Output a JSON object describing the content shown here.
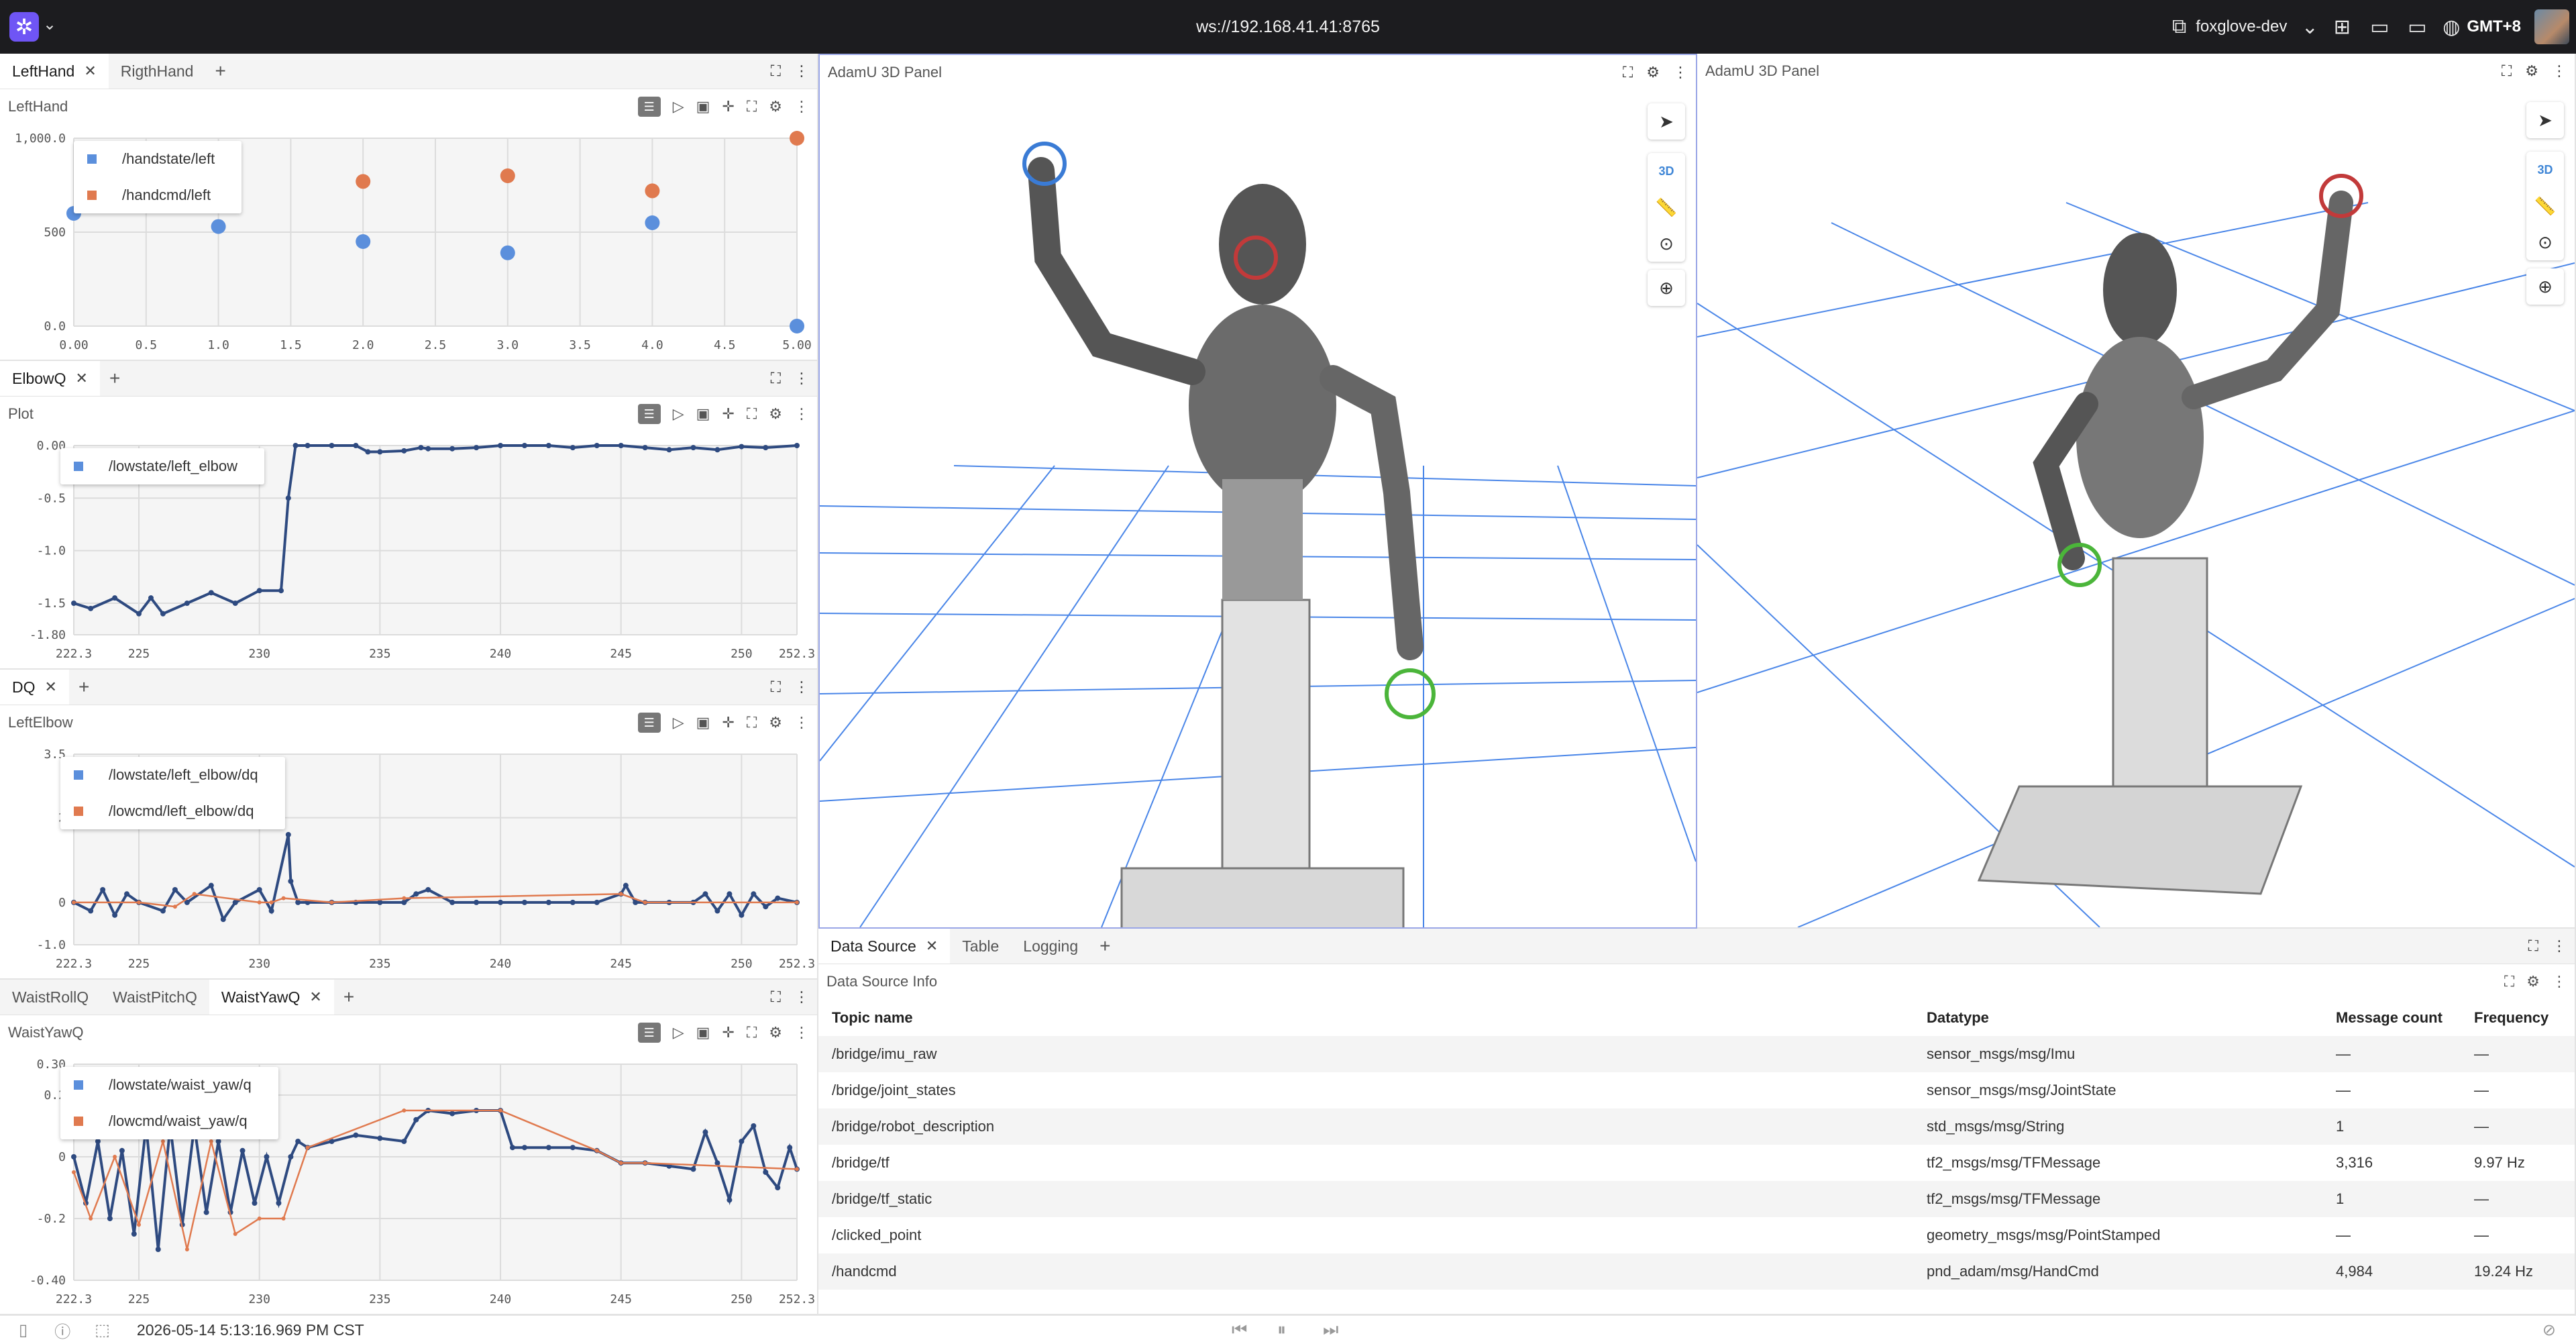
{
  "topbar": {
    "connection": "ws://192.168.41.41:8765",
    "workspace": "foxglove-dev",
    "timezone": "GMT+8",
    "icons": [
      "foxglove-logo-icon",
      "chevron-down-icon",
      "layout-icon",
      "chevron-down-icon",
      "add-panel-icon",
      "left-sidebar-icon",
      "right-sidebar-icon",
      "globe-icon",
      "avatar"
    ]
  },
  "panels": {
    "lefthand": {
      "tabs": [
        "LeftHand",
        "RigthHand"
      ],
      "title": "LeftHand",
      "legend": [
        "/handstate/left",
        "/handcmd/left"
      ]
    },
    "elbowq": {
      "tabs": [
        "ElbowQ"
      ],
      "title": "Plot",
      "legend": [
        "/lowstate/left_elbow"
      ]
    },
    "dq": {
      "tabs": [
        "DQ"
      ],
      "title": "LeftElbow",
      "legend": [
        "/lowstate/left_elbow/dq",
        "/lowcmd/left_elbow/dq"
      ]
    },
    "waist": {
      "tabs": [
        "WaistRollQ",
        "WaistPitchQ",
        "WaistYawQ"
      ],
      "title": "WaistYawQ",
      "legend": [
        "/lowstate/waist_yaw/q",
        "/lowcmd/waist_yaw/q"
      ]
    },
    "threed_a": {
      "title": "AdamU 3D Panel",
      "mode": "3D"
    },
    "threed_b": {
      "title": "AdamU 3D Panel",
      "mode": "3D"
    },
    "datasource": {
      "tabs": [
        "Data Source",
        "Table",
        "Logging"
      ],
      "title": "Data Source Info",
      "columns": [
        "Topic name",
        "Datatype",
        "Message count",
        "Frequency"
      ],
      "rows": [
        [
          "/bridge/imu_raw",
          "sensor_msgs/msg/Imu",
          "—",
          "—"
        ],
        [
          "/bridge/joint_states",
          "sensor_msgs/msg/JointState",
          "—",
          "—"
        ],
        [
          "/bridge/robot_description",
          "std_msgs/msg/String",
          "1",
          "—"
        ],
        [
          "/bridge/tf",
          "tf2_msgs/msg/TFMessage",
          "3,316",
          "9.97 Hz"
        ],
        [
          "/bridge/tf_static",
          "tf2_msgs/msg/TFMessage",
          "1",
          "—"
        ],
        [
          "/clicked_point",
          "geometry_msgs/msg/PointStamped",
          "—",
          "—"
        ],
        [
          "/handcmd",
          "pnd_adam/msg/HandCmd",
          "4,984",
          "19.24 Hz"
        ]
      ]
    }
  },
  "colors": {
    "series_a": "#5b8fdc",
    "series_b": "#e07a4f",
    "accent": "#6f55f5",
    "grid3d": "#4a86e8"
  },
  "status": {
    "timestamp": "2026-05-14 5:13:16.969 PM CST"
  },
  "chart_data": [
    {
      "type": "scatter",
      "title": "LeftHand",
      "ylim": [
        0,
        1000
      ],
      "xlim": [
        0,
        5
      ],
      "xticks": [
        "0.00",
        "0.5",
        "1.0",
        "1.5",
        "2.0",
        "2.5",
        "3.0",
        "3.5",
        "4.0",
        "4.5",
        "5.00"
      ],
      "yticks": [
        "1,000.0",
        "500",
        "0.0"
      ],
      "series": [
        {
          "name": "/handstate/left",
          "x": [
            0,
            1,
            2,
            3,
            4,
            5
          ],
          "y": [
            600,
            530,
            450,
            390,
            550,
            0
          ]
        },
        {
          "name": "/handcmd/left",
          "x": [
            2,
            3,
            4,
            5
          ],
          "y": [
            770,
            800,
            720,
            1000
          ]
        }
      ]
    },
    {
      "type": "line",
      "title": "Plot",
      "ylim": [
        -1.8,
        0
      ],
      "xlim": [
        222.3,
        252.3
      ],
      "xticks": [
        "222.3",
        "225",
        "230",
        "235",
        "240",
        "245",
        "250",
        "252.3"
      ],
      "yticks": [
        "0.00",
        "-0.5",
        "-1.0",
        "-1.5",
        "-1.80"
      ],
      "series": [
        {
          "name": "/lowstate/left_elbow",
          "x": [
            222.3,
            223,
            224,
            225,
            225.5,
            226,
            227,
            228,
            229,
            230,
            230.9,
            231.2,
            231.5,
            232,
            233,
            234,
            234.5,
            235,
            236,
            236.7,
            237,
            238,
            239,
            240,
            241,
            242,
            243,
            244,
            245,
            246,
            247,
            248,
            249,
            250,
            251,
            252.3
          ],
          "y": [
            -1.5,
            -1.55,
            -1.45,
            -1.6,
            -1.45,
            -1.6,
            -1.5,
            -1.4,
            -1.5,
            -1.38,
            -1.38,
            -0.5,
            0,
            0,
            0,
            0,
            -0.06,
            -0.06,
            -0.05,
            -0.02,
            -0.03,
            -0.03,
            -0.02,
            0,
            0,
            0,
            -0.02,
            0,
            0,
            -0.02,
            -0.04,
            -0.02,
            -0.04,
            -0.01,
            -0.02,
            0
          ]
        }
      ]
    },
    {
      "type": "line",
      "title": "LeftElbow",
      "ylim": [
        -1.0,
        3.5
      ],
      "xlim": [
        222.3,
        252.3
      ],
      "xticks": [
        "222.3",
        "225",
        "230",
        "235",
        "240",
        "245",
        "250",
        "252.3"
      ],
      "yticks": [
        "3.5",
        "2",
        "0",
        "-1.0"
      ],
      "series": [
        {
          "name": "/lowstate/left_elbow/dq",
          "x": [
            222.3,
            223,
            223.5,
            224,
            224.5,
            225,
            226,
            226.5,
            227,
            228,
            228.5,
            229,
            230,
            230.5,
            231.2,
            231.3,
            231.6,
            232,
            233,
            234,
            235,
            236,
            236.5,
            237,
            238,
            239,
            240,
            241,
            242,
            243,
            244,
            245,
            245.2,
            245.6,
            246,
            247,
            248,
            248.5,
            249,
            249.5,
            250,
            250.5,
            251,
            251.5,
            252.3
          ],
          "y": [
            0,
            -0.2,
            0.3,
            -0.3,
            0.2,
            0,
            -0.2,
            0.3,
            0,
            0.4,
            -0.4,
            0,
            0.3,
            -0.2,
            1.6,
            0.5,
            0,
            0,
            0,
            0,
            0,
            0,
            0.2,
            0.3,
            0,
            0,
            0,
            0,
            0,
            0,
            0,
            0.2,
            0.4,
            0,
            0,
            0,
            0,
            0.2,
            -0.2,
            0.2,
            -0.3,
            0.2,
            -0.1,
            0.1,
            0
          ]
        },
        {
          "name": "/lowcmd/left_elbow/dq",
          "x": [
            222.3,
            225,
            226.5,
            227.3,
            230,
            230.5,
            231,
            233,
            236,
            245,
            246,
            252.3
          ],
          "y": [
            0,
            0,
            -0.1,
            0.2,
            0,
            0,
            0.1,
            0,
            0.1,
            0.2,
            0,
            0
          ]
        }
      ]
    },
    {
      "type": "line",
      "title": "WaistYawQ",
      "ylim": [
        -0.4,
        0.3
      ],
      "xlim": [
        222.3,
        252.3
      ],
      "xticks": [
        "222.3",
        "225",
        "230",
        "235",
        "240",
        "245",
        "250",
        "252.3"
      ],
      "yticks": [
        "0.30",
        "0.2",
        "0",
        "-0.2",
        "-0.40"
      ],
      "series": [
        {
          "name": "/lowstate/waist_yaw/q",
          "x": [
            222.3,
            222.8,
            223.3,
            223.8,
            224.3,
            224.8,
            225.3,
            225.8,
            226.3,
            226.8,
            227.3,
            227.8,
            228.3,
            228.8,
            229.3,
            229.8,
            230.3,
            230.8,
            231.3,
            231.6,
            232,
            233,
            234,
            235,
            236,
            236.5,
            237,
            238,
            239,
            240,
            240.5,
            241,
            242,
            243,
            244,
            245,
            246,
            247,
            248,
            248.5,
            249,
            249.5,
            250,
            250.5,
            251,
            251.5,
            252,
            252.3
          ],
          "y": [
            0,
            -0.15,
            0.05,
            -0.2,
            0.02,
            -0.25,
            0.1,
            -0.3,
            0.1,
            -0.22,
            0.1,
            -0.18,
            0.05,
            -0.18,
            0.02,
            -0.15,
            0,
            -0.15,
            0,
            0.05,
            0.03,
            0.05,
            0.07,
            0.06,
            0.05,
            0.12,
            0.15,
            0.14,
            0.15,
            0.15,
            0.03,
            0.03,
            0.03,
            0.03,
            0.02,
            -0.02,
            -0.02,
            -0.03,
            -0.04,
            0.08,
            -0.02,
            -0.14,
            0.05,
            0.1,
            -0.05,
            -0.1,
            0.03,
            -0.04
          ]
        },
        {
          "name": "/lowcmd/waist_yaw/q",
          "x": [
            222.3,
            223,
            224,
            225,
            226,
            227,
            228,
            229,
            230,
            231,
            232,
            236,
            240,
            244,
            245,
            246,
            252.3
          ],
          "y": [
            -0.05,
            -0.2,
            0,
            -0.22,
            0.05,
            -0.3,
            0.05,
            -0.25,
            -0.2,
            -0.2,
            0.03,
            0.15,
            0.15,
            0.02,
            -0.02,
            -0.02,
            -0.04
          ]
        }
      ]
    }
  ]
}
